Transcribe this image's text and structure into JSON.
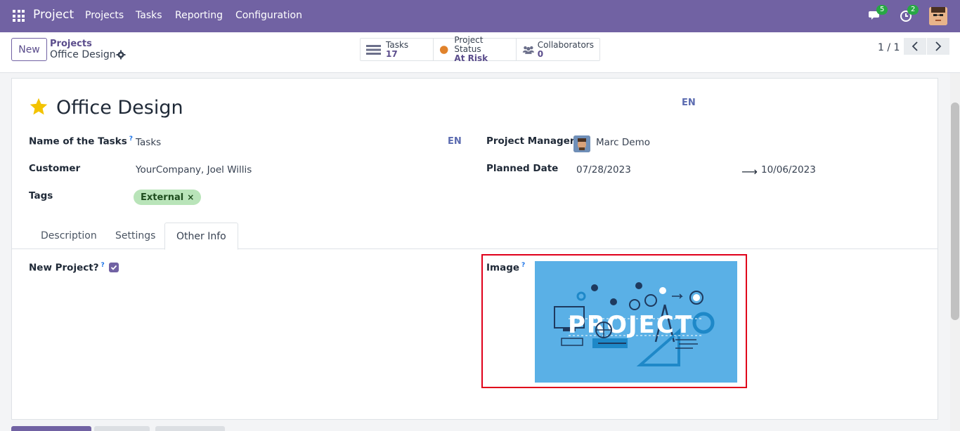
{
  "navbar": {
    "brand": "Project",
    "menu": [
      "Projects",
      "Tasks",
      "Reporting",
      "Configuration"
    ],
    "messages_count": "5",
    "activities_count": "2",
    "bg_color": "#7162a3"
  },
  "control_panel": {
    "new_label": "New",
    "breadcrumb_parent": "Projects",
    "breadcrumb_current": "Office Design",
    "smart_buttons": {
      "tasks": {
        "label": "Tasks",
        "value": "17"
      },
      "status": {
        "label": "Project Status",
        "value": "At Risk"
      },
      "collaborators": {
        "label": "Collaborators",
        "value": "0"
      }
    },
    "pager": "1 / 1"
  },
  "form": {
    "title": "Office Design",
    "lang_title": "EN",
    "lang_tasks": "EN",
    "fields": {
      "name_of_tasks_label": "Name of the Tasks",
      "name_of_tasks_help": "?",
      "name_of_tasks_value": "Tasks",
      "customer_label": "Customer",
      "customer_value": "YourCompany, Joel Willis",
      "tags_label": "Tags",
      "tag_value": "External",
      "project_manager_label": "Project Manager",
      "project_manager_value": "Marc Demo",
      "planned_date_label": "Planned Date",
      "planned_date_start": "07/28/2023",
      "planned_date_end": "10/06/2023"
    },
    "tabs": [
      "Description",
      "Settings",
      "Other Info"
    ],
    "active_tab": "Other Info",
    "other_info": {
      "new_project_label": "New Project?",
      "new_project_help": "?",
      "new_project_checked": true,
      "image_label": "Image",
      "image_help": "?",
      "image_text": "PROJECT"
    }
  },
  "colors": {
    "accent": "#7162a3",
    "tag_bg": "#b9e4b9",
    "highlight": "#e0001a",
    "image_bg": "#5ab0e6"
  }
}
